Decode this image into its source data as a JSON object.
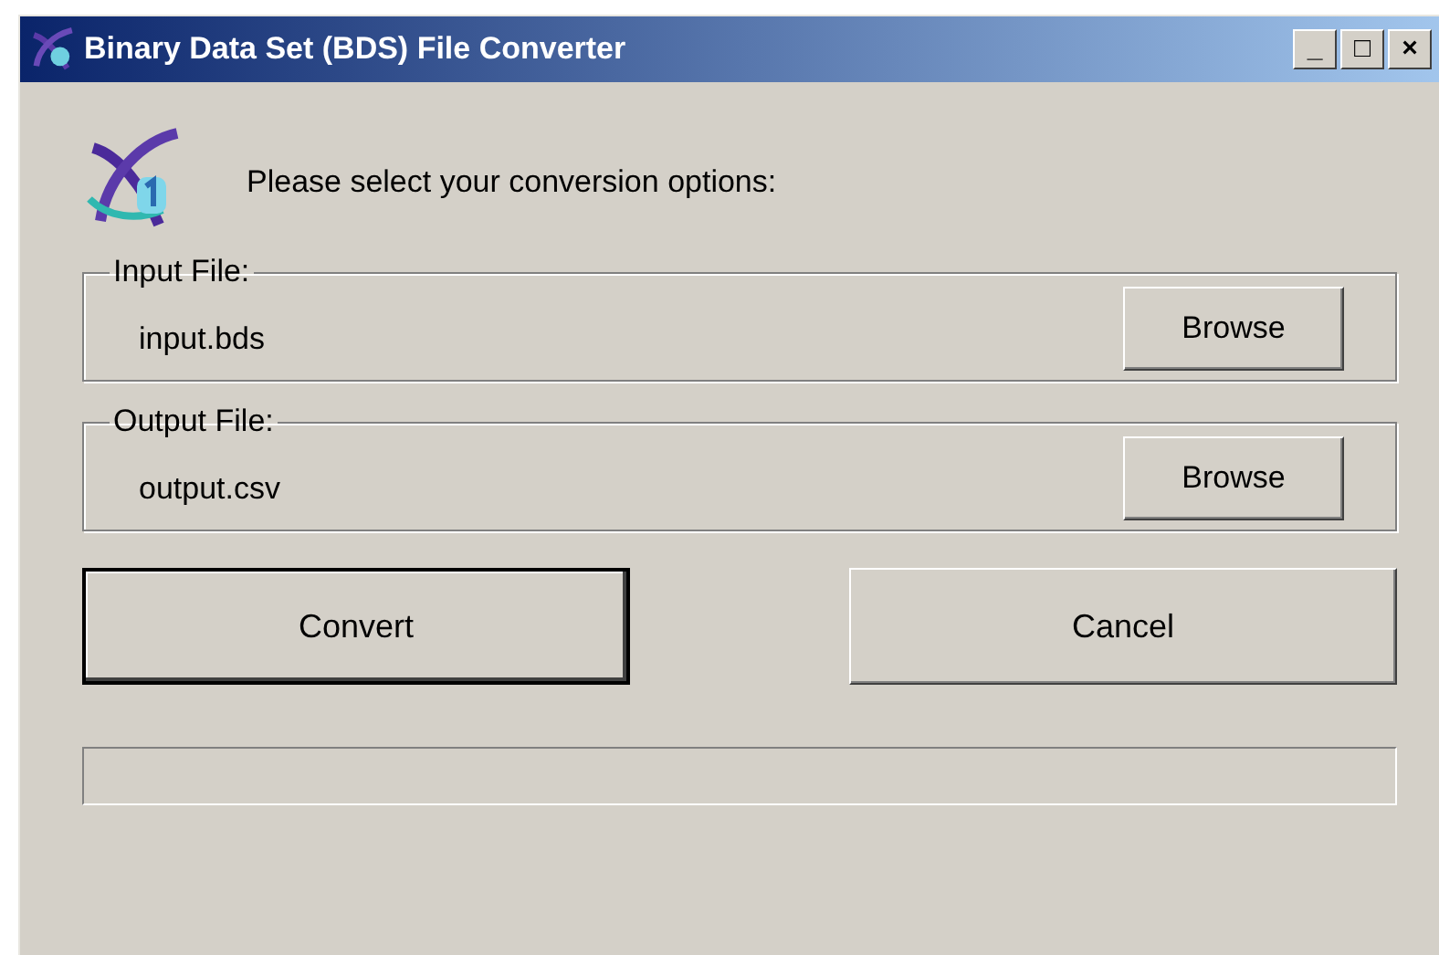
{
  "window": {
    "title": "Binary Data Set (BDS) File Converter",
    "controls": [
      "_",
      "□",
      "×"
    ]
  },
  "prompt": "Please select your conversion options:",
  "groups": [
    {
      "label": "Input File:",
      "value": "input.bds",
      "button": "Browse"
    },
    {
      "label": "Output File:",
      "value": "output.csv",
      "button": "Browse"
    }
  ],
  "buttons": [
    {
      "label": "Convert",
      "default": true
    },
    {
      "label": "Cancel",
      "default": false
    }
  ]
}
